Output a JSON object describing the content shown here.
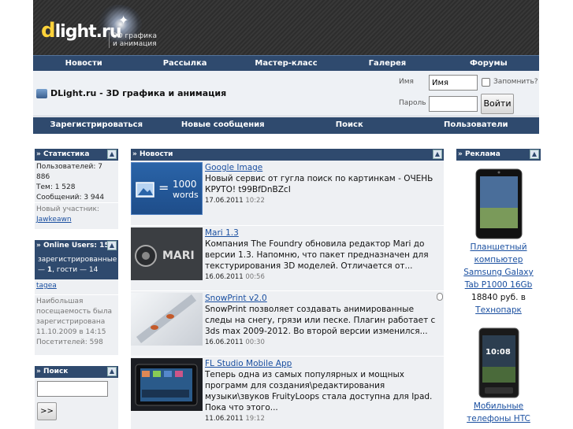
{
  "header": {
    "logo_prefix": "d",
    "logo_rest": "light.ru",
    "logo_sub1": "3D графика",
    "logo_sub2": "и анимация"
  },
  "nav": [
    "Новости",
    "Рассылка",
    "Мастер-класс",
    "Галерея",
    "Форумы"
  ],
  "site_title": "DLight.ru - 3D графика и анимация",
  "login": {
    "name_label": "Имя",
    "name_value": "Имя",
    "remember_label": "Запомнить?",
    "password_label": "Пароль",
    "submit_label": "Войти"
  },
  "subnav": [
    "Зарегистрироваться",
    "Новые сообщения",
    "Поиск",
    "Пользователи"
  ],
  "stats": {
    "title": "» Статистика",
    "users": "Пользователей: 7 886",
    "topics": "Тем: 1 528",
    "posts": "Сообщений: 3 944",
    "new_member_label": "Новый участник:",
    "new_member": "Jawkeawn"
  },
  "online": {
    "title": "» Online Users: 15",
    "line1": "зарегистрированные",
    "line2_prefix": "— ",
    "registered_count": "1",
    "line2_suffix": ", гости — 14",
    "user": "tagea",
    "max1": "Наибольшая",
    "max2": "посещаемость была",
    "max3": "зарегистрирована",
    "max4": "11.10.2009 в 14:15",
    "max5": "Посетителей: 598"
  },
  "search": {
    "title": "» Поиск",
    "button": ">>"
  },
  "news": {
    "title": "» Новости",
    "items": [
      {
        "title": "Google Image",
        "line1": "Новый сервис от гугла поиск по картинкам - ОЧЕНЬ",
        "line2": "КРУТО! t99BfDnBZcI",
        "date": "17.06.2011",
        "time": "10:22",
        "thumb_text1": "1000",
        "thumb_text2": "words",
        "thumb_eq": "="
      },
      {
        "title": "Mari 1.3",
        "line1": "Компания The Foundry обновила редактор Mari до",
        "line2": "версии 1.3. Напомню, что пакет предназначен для",
        "line3": "текстурирования 3D моделей. Отличается от...",
        "date": "16.06.2011",
        "time": "00:56",
        "thumb_text1": "MARI"
      },
      {
        "title": "SnowPrint v2.0",
        "line1": "SnowPrint позволяет создавать анимированные",
        "line2": "следы на снегу, грязи или песке. Плагин работает с",
        "line3": "3ds max 2009-2012. Во второй версии изменился...",
        "date": "16.06.2011",
        "time": "00:30"
      },
      {
        "title": "FL Studio Mobile App",
        "line1": "Теперь одна из самых популярных и мощных",
        "line2": "программ для создания\\редактирования",
        "line3": "музыки\\звуков FruityLoops стала доступна для Ipad.",
        "line4": "Пока что этого...",
        "date": "11.06.2011",
        "time": "19:12"
      }
    ]
  },
  "ads": {
    "title": "» Реклама",
    "item1": {
      "l1": "Планшетный",
      "l2": "компьютер",
      "l3": "Samsung Galaxy",
      "l4": "Tab P1000 16Gb",
      "price": "18840 руб. в",
      "shop": "Технопарк"
    },
    "item2": {
      "phone_time": "10:08",
      "l1": "Мобильные",
      "l2": "телефоны HTC"
    }
  }
}
